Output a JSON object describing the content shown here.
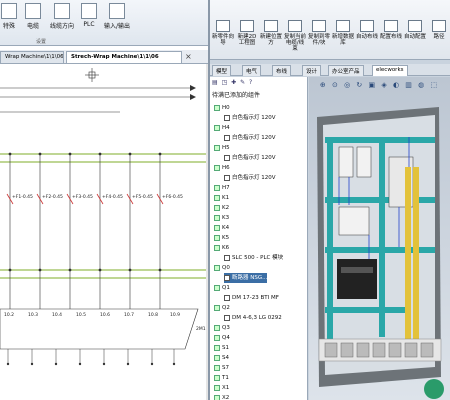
{
  "left": {
    "ribbon": {
      "buttons": [
        "特殊",
        "电缆",
        "线缆方向",
        "PLC",
        "输入/输出"
      ],
      "group_label": "设置"
    },
    "tabs": [
      {
        "label": "Wrap Machine\\1\\1\\06"
      },
      {
        "label": "Strech-Wrap Machine\\1\\1\\06"
      }
    ],
    "close_glyph": "×",
    "diagram": {
      "branch_labels": [
        "+F1-0.45",
        "+F2-0.45",
        "+F3-0.45",
        "+F4-0.45",
        "+F5-0.45",
        "+F6-0.45"
      ],
      "bottom_refs": [
        "10.2",
        "10.3",
        "10.4",
        "10.5",
        "10.6",
        "10.7",
        "10.8",
        "10.9"
      ],
      "right_label": "2M1"
    }
  },
  "right": {
    "ribbon": {
      "buttons": [
        "新零件向导",
        "新建2D工程图",
        "新建位置方",
        "复制当前电缆/线束",
        "复制到零件/块",
        "新增数据库",
        "自动布线",
        "配置布线",
        "自动配置",
        "路径"
      ]
    },
    "tabs": [
      "模型",
      "电气",
      "布线",
      "设计",
      "办公室产品",
      "elecworks"
    ],
    "tree": {
      "toolbar_icons": "▤ ◳ ✚ ✎ ?",
      "header": "待满已添加的组件",
      "items": [
        {
          "label": "H0",
          "kind": "tag"
        },
        {
          "label": "白色指示灯 120V",
          "kind": "check"
        },
        {
          "label": "H4",
          "kind": "tag"
        },
        {
          "label": "白色指示灯 120V",
          "kind": "check"
        },
        {
          "label": "H5",
          "kind": "tag"
        },
        {
          "label": "白色指示灯 120V",
          "kind": "check"
        },
        {
          "label": "H6",
          "kind": "tag"
        },
        {
          "label": "白色指示灯 120V",
          "kind": "check"
        },
        {
          "label": "H7",
          "kind": "tag"
        },
        {
          "label": "K1",
          "kind": "tag"
        },
        {
          "label": "K2",
          "kind": "tag"
        },
        {
          "label": "K3",
          "kind": "tag"
        },
        {
          "label": "K4",
          "kind": "tag"
        },
        {
          "label": "K5",
          "kind": "tag"
        },
        {
          "label": "K6",
          "kind": "tag"
        },
        {
          "label": "SLC 500 - PLC 模块",
          "kind": "check"
        },
        {
          "label": "Q0",
          "kind": "tag"
        },
        {
          "label": "断路器 NSG...",
          "kind": "check",
          "selected": true
        },
        {
          "label": "Q1",
          "kind": "tag"
        },
        {
          "label": "DM 17-23 BTI MF",
          "kind": "check"
        },
        {
          "label": "Q2",
          "kind": "tag"
        },
        {
          "label": "DM 4-6,3 LG 0292",
          "kind": "check"
        },
        {
          "label": "Q3",
          "kind": "tag"
        },
        {
          "label": "Q4",
          "kind": "tag"
        },
        {
          "label": "S1",
          "kind": "tag"
        },
        {
          "label": "S4",
          "kind": "tag"
        },
        {
          "label": "S7",
          "kind": "tag"
        },
        {
          "label": "T1",
          "kind": "tag"
        },
        {
          "label": "X1",
          "kind": "tag"
        },
        {
          "label": "X2",
          "kind": "tag"
        }
      ]
    },
    "view_toolbar": "⊕ ⊙ ◎ ↻ ▣ ◈ ◐ ▥ ◍ ⬚"
  },
  "colors": {
    "teal": "#2aa7a8",
    "panel_back": "#d8dee4",
    "cabinet_gray": "#6d7378",
    "wire_blue": "#2244cc",
    "busbar_green": "#7fae2a",
    "yellow": "#e3c23a"
  }
}
